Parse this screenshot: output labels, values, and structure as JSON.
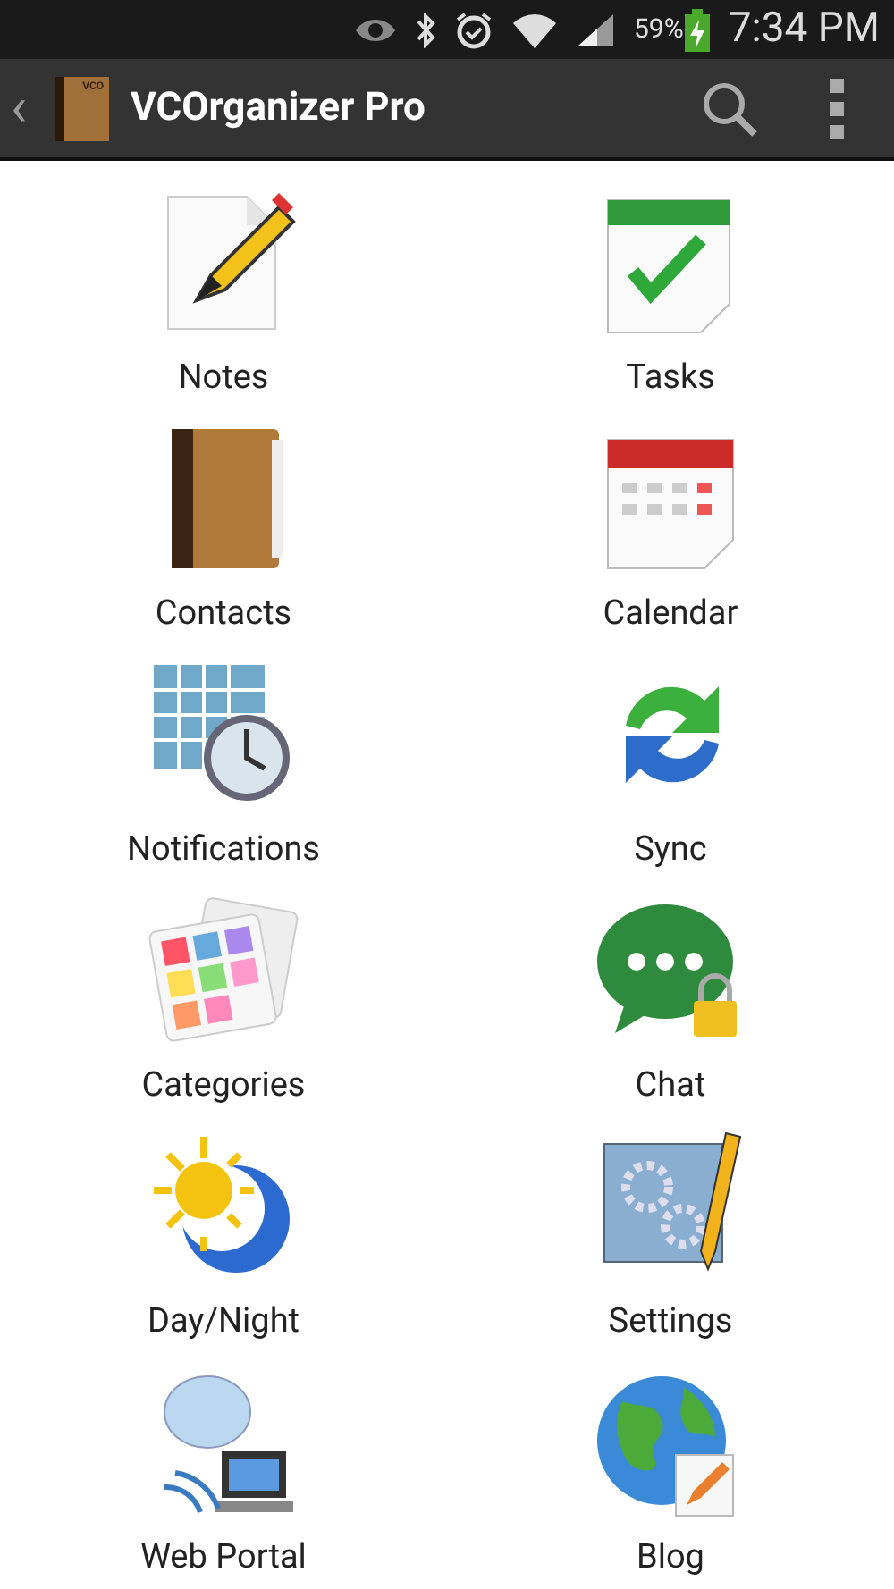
{
  "status_bar": {
    "battery": "59%",
    "time": "7:34 PM"
  },
  "action_bar": {
    "back": "‹",
    "logo_text": "VCO",
    "title": "VCOrganizer Pro"
  },
  "items": [
    {
      "kind": "notes",
      "label": "Notes"
    },
    {
      "kind": "tasks",
      "label": "Tasks"
    },
    {
      "kind": "contacts",
      "label": "Contacts"
    },
    {
      "kind": "calendar",
      "label": "Calendar"
    },
    {
      "kind": "notifications",
      "label": "Notifications"
    },
    {
      "kind": "sync",
      "label": "Sync"
    },
    {
      "kind": "categories",
      "label": "Categories"
    },
    {
      "kind": "chat",
      "label": "Chat"
    },
    {
      "kind": "daynight",
      "label": "Day/Night"
    },
    {
      "kind": "settings",
      "label": "Settings"
    },
    {
      "kind": "webportal",
      "label": "Web Portal"
    },
    {
      "kind": "blog",
      "label": "Blog"
    }
  ]
}
